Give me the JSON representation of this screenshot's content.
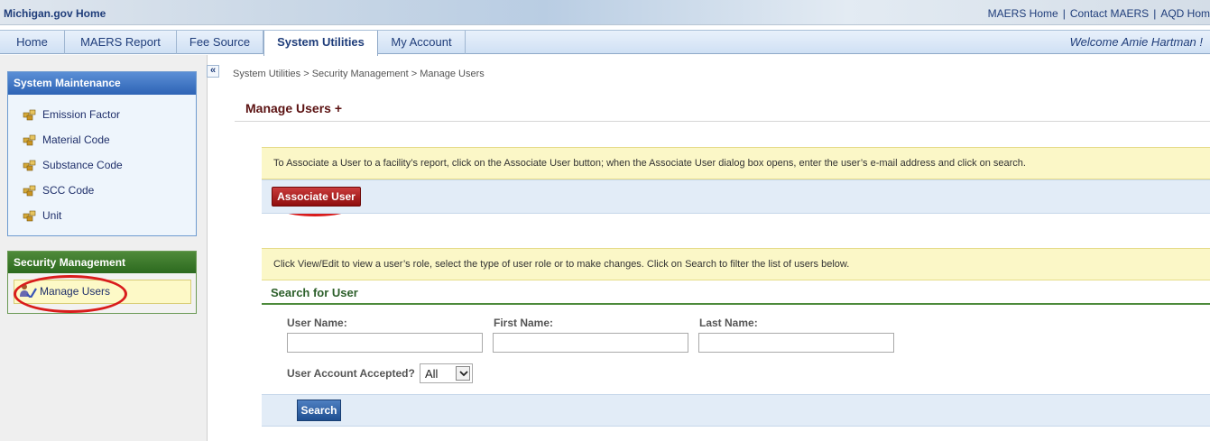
{
  "topbar": {
    "home_link": "Michigan.gov Home",
    "links": [
      "MAERS Home",
      "Contact MAERS",
      "AQD Hom"
    ],
    "separator": "|"
  },
  "nav": {
    "tabs": [
      {
        "label": "Home",
        "active": false
      },
      {
        "label": "MAERS Report",
        "active": false
      },
      {
        "label": "Fee Source",
        "active": false
      },
      {
        "label": "System Utilities",
        "active": true
      },
      {
        "label": "My Account",
        "active": false
      }
    ],
    "welcome": "Welcome Amie Hartman !"
  },
  "sidebar": {
    "system_maintenance": {
      "title": "System Maintenance",
      "items": [
        "Emission Factor",
        "Material Code",
        "Substance Code",
        "SCC Code",
        "Unit"
      ]
    },
    "security_management": {
      "title": "Security Management",
      "items": [
        "Manage Users"
      ]
    },
    "collapse_icon": "«"
  },
  "main": {
    "breadcrumb": "System Utilities > Security Management > Manage Users",
    "title": "Manage Users +",
    "associate_info": "To Associate a User to a facility’s report, click on the Associate User button; when the Associate User dialog box opens, enter the user’s e-mail address and click on search.",
    "associate_button": "Associate User",
    "view_info": "Click View/Edit to view a user’s role, select the type of user role or to make changes. Click on Search to filter the list of users below.",
    "search": {
      "header": "Search for User",
      "fields": [
        {
          "label": "User Name:",
          "value": ""
        },
        {
          "label": "First Name:",
          "value": ""
        },
        {
          "label": "Last Name:",
          "value": ""
        }
      ],
      "accepted_label": "User Account Accepted?",
      "accepted_value": "All",
      "button": "Search"
    }
  },
  "colors": {
    "highlight_oval": "#d91c1c",
    "system_maintenance_header": "#2d63b5",
    "security_management_header": "#2c6a1f",
    "title_color": "#5b1212"
  }
}
